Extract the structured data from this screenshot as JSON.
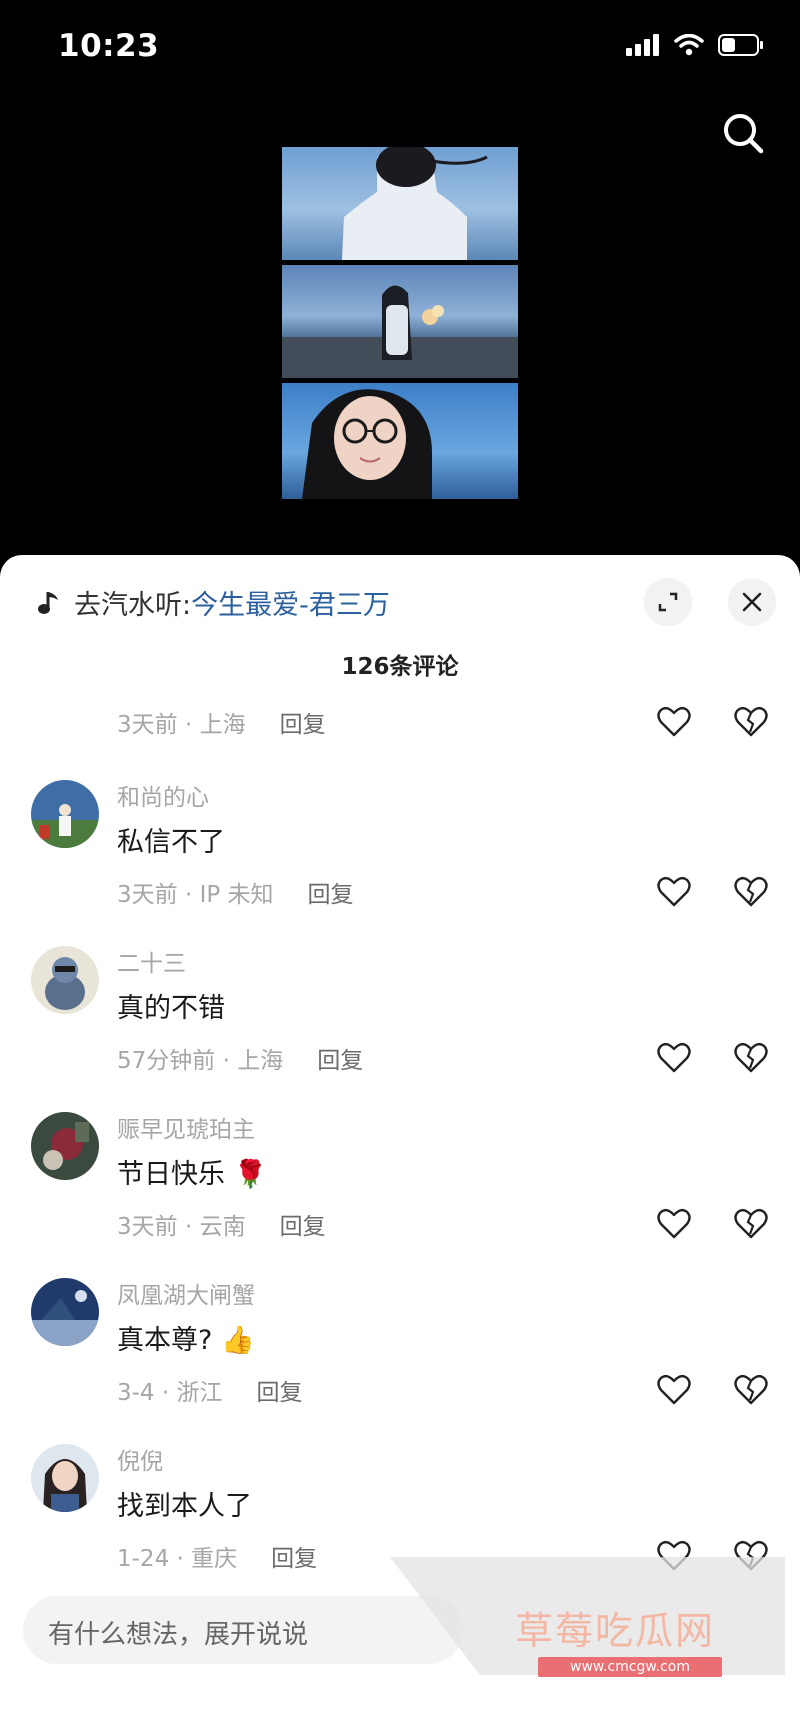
{
  "status": {
    "time": "10:23"
  },
  "music": {
    "prefix": "去汽水听:",
    "song": "今生最爱-君三万"
  },
  "comments_count": "126条评论",
  "partial_meta": {
    "time_location": "3天前 · 上海",
    "reply": "回复"
  },
  "comments": [
    {
      "user": "和尚的心",
      "content": "私信不了",
      "time_location": "3天前 · IP 未知",
      "reply": "回复",
      "emoji": ""
    },
    {
      "user": "二十三",
      "content": "真的不错",
      "time_location": "57分钟前 · 上海",
      "reply": "回复",
      "emoji": ""
    },
    {
      "user": "赈早见琥珀主",
      "content": "节日快乐",
      "time_location": "3天前 · 云南",
      "reply": "回复",
      "emoji": "🌹"
    },
    {
      "user": "凤凰湖大闸蟹",
      "content": "真本尊?",
      "time_location": "3-4 · 浙江",
      "reply": "回复",
      "emoji": "👍"
    },
    {
      "user": "倪倪",
      "content": "找到本人了",
      "time_location": "1-24 · 重庆",
      "reply": "回复",
      "emoji": ""
    }
  ],
  "input": {
    "placeholder": "有什么想法，展开说说"
  },
  "watermark": {
    "title": "草莓吃瓜网",
    "url": "www.cmcgw.com"
  },
  "colors": {
    "song_link": "#2b5f9e",
    "watermark": "#f4b7a3",
    "watermark_badge": "#e96f73"
  }
}
